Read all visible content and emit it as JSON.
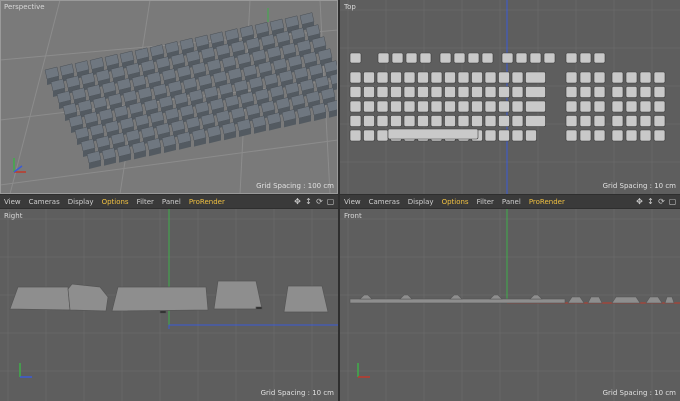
{
  "viewports": {
    "perspective": {
      "label": "Perspective",
      "grid": "Grid Spacing : 100 cm"
    },
    "top": {
      "label": "Top",
      "grid": "Grid Spacing : 10 cm"
    },
    "right": {
      "label": "Right",
      "grid": "Grid Spacing : 10 cm"
    },
    "front": {
      "label": "Front",
      "grid": "Grid Spacing : 10 cm"
    }
  },
  "menu": {
    "view": "View",
    "cameras": "Cameras",
    "display": "Display",
    "options": "Options",
    "filter": "Filter",
    "panel": "Panel",
    "prorender": "ProRender"
  },
  "icons": [
    "move-icon",
    "pan-arrows-icon",
    "rotate-icon",
    "maximize-icon"
  ],
  "colors": {
    "highlight": "#f0c040",
    "axis_x": "#c0392b",
    "axis_y": "#3fae49",
    "axis_z": "#3b5bd6"
  }
}
